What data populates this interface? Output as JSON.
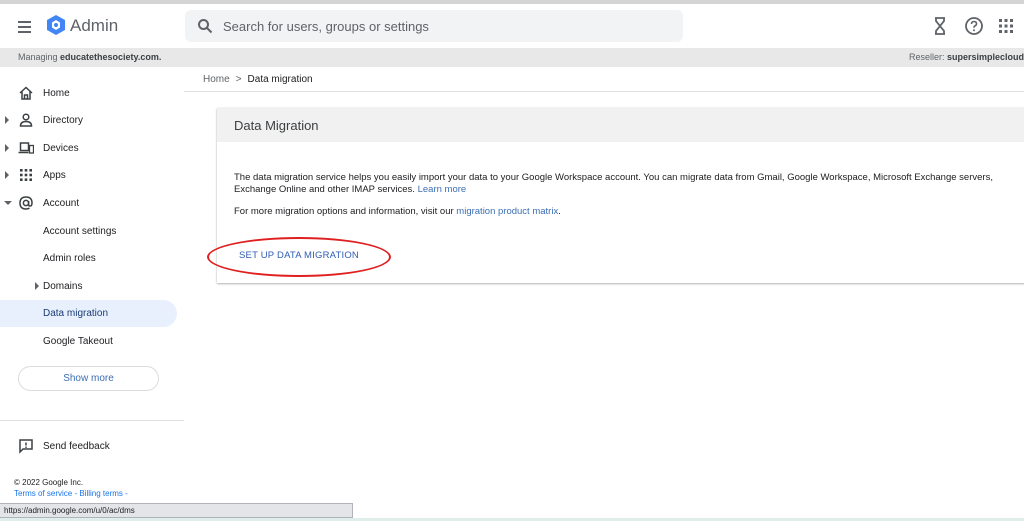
{
  "app": {
    "title": "Admin"
  },
  "search": {
    "placeholder": "Search for users, groups or settings"
  },
  "managing": {
    "prefix": "Managing ",
    "domain": "educatethesociety.com.",
    "reseller_prefix": "Reseller: ",
    "reseller": "supersimplecloud"
  },
  "sidebar": {
    "items": [
      {
        "label": "Home",
        "icon": "home-icon"
      },
      {
        "label": "Directory",
        "icon": "person-icon"
      },
      {
        "label": "Devices",
        "icon": "devices-icon"
      },
      {
        "label": "Apps",
        "icon": "apps-grid-icon"
      },
      {
        "label": "Account",
        "icon": "at-sign-icon"
      },
      {
        "label": "Account settings"
      },
      {
        "label": "Admin roles"
      },
      {
        "label": "Domains"
      },
      {
        "label": "Data migration"
      },
      {
        "label": "Google Takeout"
      }
    ],
    "show_more": "Show more",
    "send_feedback": "Send feedback",
    "copyright": "© 2022 Google Inc.",
    "footer_links": "Terms of service - Billing terms -"
  },
  "status_url": "https://admin.google.com/u/0/ac/dms",
  "breadcrumb": {
    "home": "Home",
    "separator": ">",
    "current": "Data migration"
  },
  "card": {
    "title": "Data Migration",
    "description": "The data migration service helps you easily import your data to your Google Workspace account. You can migrate data from Gmail, Google Workspace, Microsoft Exchange servers, Exchange Online and other IMAP services.",
    "learn_more": "Learn more",
    "more_info_prefix": "For more migration options and information, visit our ",
    "matrix_link": "migration product matrix",
    "more_info_suffix": ".",
    "setup_button": "SET UP DATA MIGRATION"
  },
  "colors": {
    "accent": "#1a73e8",
    "logo_blue": "#4285f4",
    "active_bg": "#e8f0fe",
    "highlight_ellipse": "#e02020"
  }
}
